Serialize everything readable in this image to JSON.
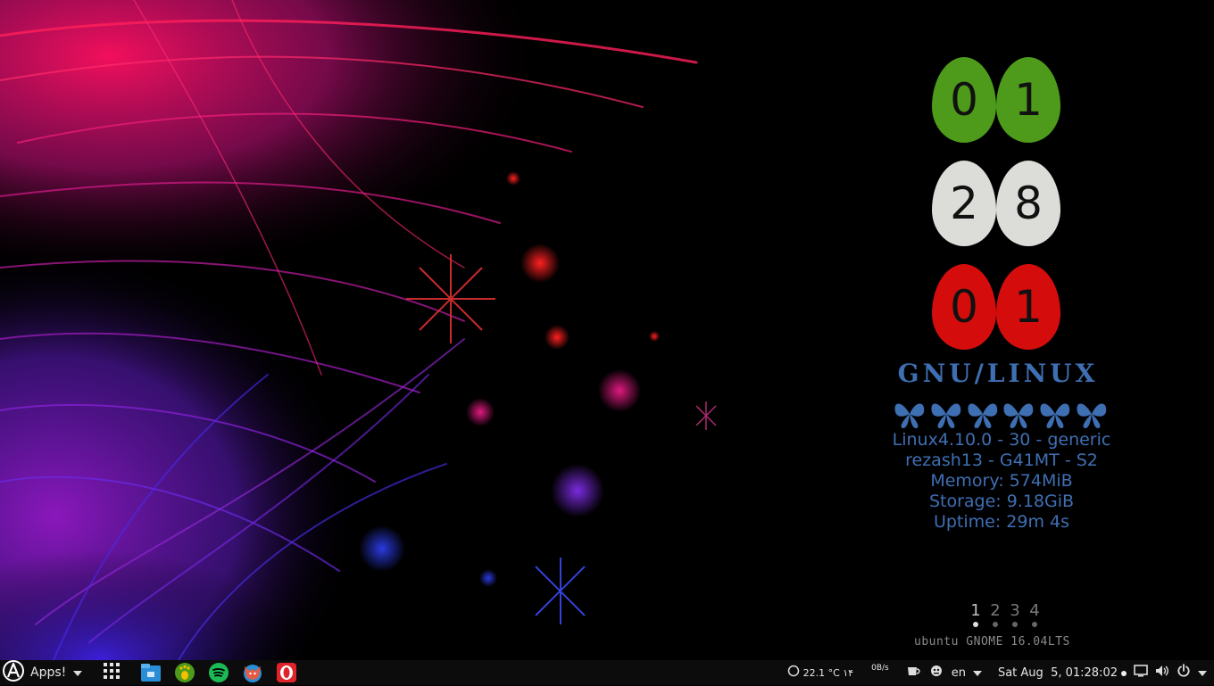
{
  "clock": {
    "hours": [
      "0",
      "1"
    ],
    "minutes": [
      "2",
      "8"
    ],
    "seconds": [
      "0",
      "1"
    ],
    "colors": {
      "hours": "#4e9a1a",
      "minutes": "#dcdcd8",
      "seconds": "#d40c0c"
    }
  },
  "conky": {
    "title": "GNU/LINUX",
    "butterfly_count": 6,
    "kernel": "Linux4.10.0 - 30 - generic",
    "host": "rezash13 - G41MT - S2",
    "memory": "Memory: 574MiB",
    "storage": "Storage: 9.18GiB",
    "uptime": "Uptime: 29m 4s",
    "text_color": "#3f6fb3"
  },
  "workspaces": {
    "items": [
      "1",
      "2",
      "3",
      "4"
    ],
    "active_index": 0
  },
  "distro_label": "ubuntu GNOME 16.04LTS",
  "taskbar": {
    "apps_label": "Apps!",
    "apps_icon": "arch-a-icon",
    "launchers": [
      {
        "name": "files-icon",
        "color": "#2a8ed6"
      },
      {
        "name": "gnome-foot-icon",
        "color": "#4e9a1a"
      },
      {
        "name": "spotify-icon",
        "color": "#1db954"
      },
      {
        "name": "browser-fox-icon",
        "color": "#e45b45"
      },
      {
        "name": "opera-icon",
        "color": "#e0242a"
      }
    ],
    "weather": "22.1 °C ۱۴",
    "network_speed": "0B/s",
    "language": "en",
    "datetime": "Sat Aug  5, 01:28:02"
  }
}
